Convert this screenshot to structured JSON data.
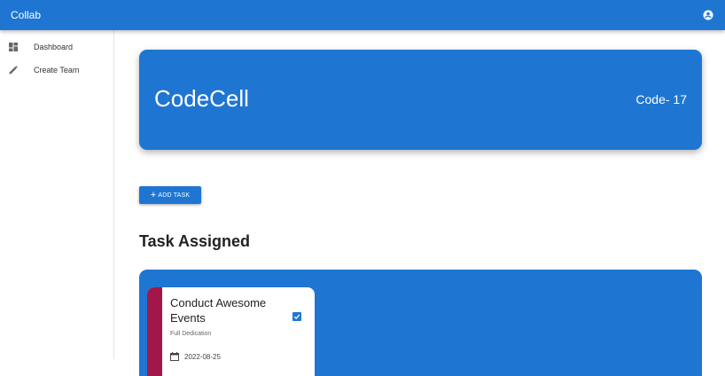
{
  "appbar": {
    "title": "Collab",
    "account_icon": "account-circle-icon"
  },
  "sidebar": {
    "items": [
      {
        "label": "Dashboard",
        "icon": "dashboard-icon"
      },
      {
        "label": "Create Team",
        "icon": "pencil-icon"
      }
    ]
  },
  "team": {
    "name": "CodeCell",
    "code": "Code- 17"
  },
  "actions": {
    "add_task_label": "ADD TASK"
  },
  "tasks_section": {
    "title": "Task Assigned",
    "tasks": [
      {
        "title": "Conduct Awesome Events",
        "description": "Full Dedication",
        "date": "2022-08-25",
        "completed": true
      }
    ]
  },
  "colors": {
    "primary": "#1e76d2",
    "task_stripe": "#a3164a"
  }
}
